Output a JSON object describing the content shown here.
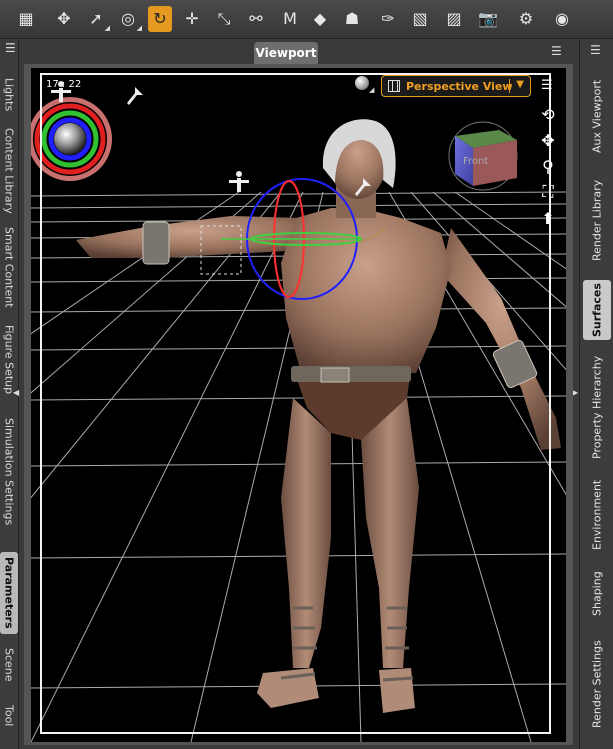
{
  "toolbar": {
    "tools": [
      {
        "name": "grid-menu-icon",
        "glyph": "▦"
      },
      {
        "name": "universal-tool-icon",
        "glyph": "✥"
      },
      {
        "name": "node-selection-icon",
        "glyph": "➚"
      },
      {
        "name": "surface-selection-icon",
        "glyph": "◎"
      },
      {
        "name": "rotate-tool-icon",
        "glyph": "↻",
        "active": true
      },
      {
        "name": "translate-tool-icon",
        "glyph": "✛"
      },
      {
        "name": "scale-tool-icon",
        "glyph": "⤡"
      },
      {
        "name": "joint-editor-icon",
        "glyph": "⚯"
      },
      {
        "name": "geometry-editor-icon",
        "glyph": "M"
      },
      {
        "name": "surface-tool-icon",
        "glyph": "◆"
      },
      {
        "name": "power-pose-icon",
        "glyph": "☗"
      },
      {
        "name": "geometry-sculptor-icon",
        "glyph": "✑"
      },
      {
        "name": "weight-map-icon",
        "glyph": "▧"
      },
      {
        "name": "spot-render-icon",
        "glyph": "▨"
      },
      {
        "name": "camera-tool-icon",
        "glyph": "📷"
      },
      {
        "name": "settings-pointer-icon",
        "glyph": "⚙"
      },
      {
        "name": "render-icon",
        "glyph": "◉"
      }
    ]
  },
  "left_tabs": [
    "Lights",
    "Content Library",
    "Smart Content",
    "Figure Setup",
    "Simulation Settings",
    "Parameters",
    "Scene",
    "Tool"
  ],
  "left_active": "Parameters",
  "right_tabs": [
    "Aux Viewport",
    "Render Library",
    "Surfaces",
    "Property Hierarchy",
    "Environment",
    "Shaping",
    "Render Settings"
  ],
  "right_active": "Surfaces",
  "viewport": {
    "tab_label": "Viewport",
    "frame_label": "17 : 22",
    "camera_label": "Perspective View",
    "cube_label": "Front"
  },
  "colors": {
    "accent": "#e59a1f",
    "rotate_x": "#ff3030",
    "rotate_y": "#40d040",
    "rotate_z": "#2020ff"
  }
}
